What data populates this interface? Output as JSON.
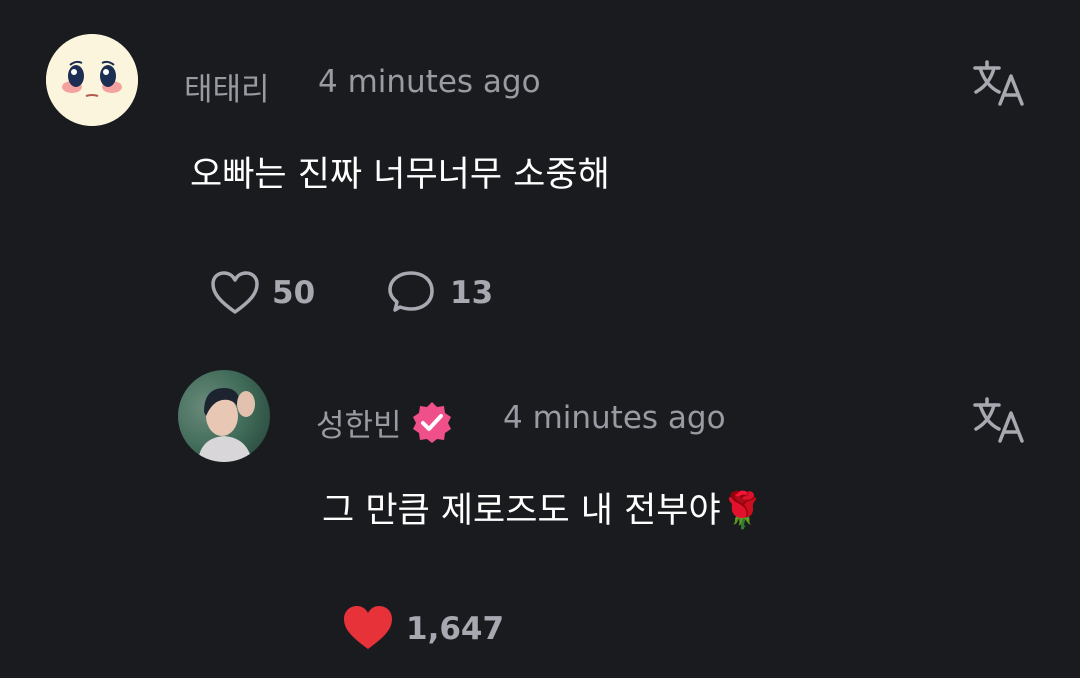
{
  "comment": {
    "author": "태태리",
    "time": "4 minutes ago",
    "text": "오빠는 진짜 너무너무 소중해",
    "likes": "50",
    "replies": "13",
    "avatar_icon": "crying-face-emoji-avatar",
    "translate_icon": "translate-icon"
  },
  "reply": {
    "author": "성한빈",
    "verified_icon": "verified-badge-icon",
    "time": "4 minutes ago",
    "text": "그 만큼 제로즈도 내 전부야",
    "emoji": "🌹",
    "likes": "1,647",
    "liked": true,
    "avatar_icon": "user-photo-avatar",
    "translate_icon": "translate-icon"
  },
  "colors": {
    "background": "#1a1b1f",
    "liked_heart": "#e8323a",
    "verified_badge": "#f0508a"
  }
}
